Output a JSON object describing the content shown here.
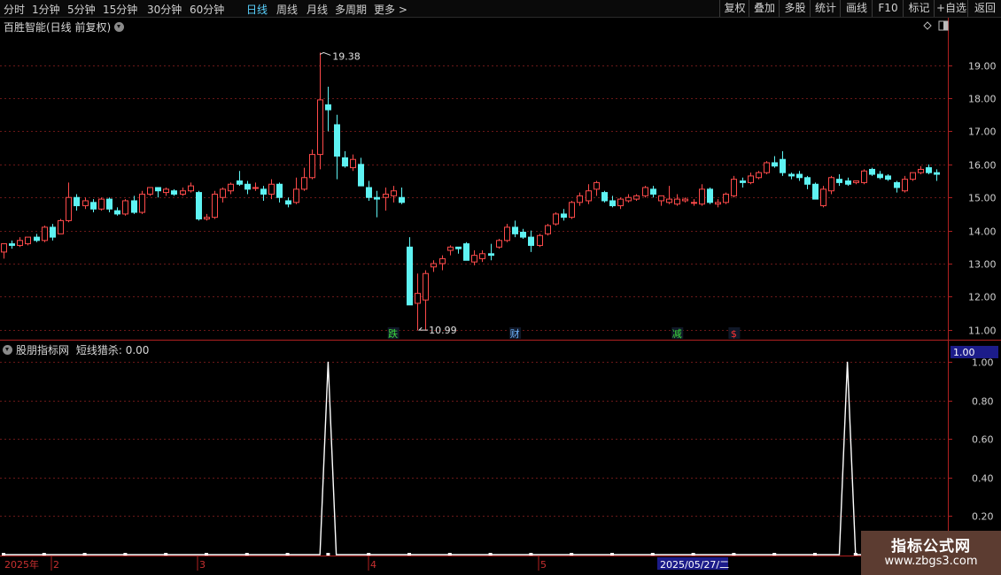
{
  "toolbar": {
    "periods": [
      "分时",
      "1分钟",
      "5分钟",
      "15分钟",
      "30分钟",
      "60分钟",
      "日线",
      "周线",
      "月线",
      "多周期",
      "更多 >"
    ],
    "active_period": "日线",
    "right_buttons": [
      "复权",
      "叠加",
      "多股",
      "统计",
      "画线",
      "F10",
      "标记",
      "+自选",
      "返回"
    ]
  },
  "main_panel": {
    "title": "百胜智能(日线 前复权)",
    "high_label": "19.38",
    "low_label": "10.99",
    "event_markers": [
      {
        "label": "跌",
        "color": "#3ddc3d",
        "date": "2025/04/08"
      },
      {
        "label": "财",
        "color": "#6fb5ff",
        "date": "2025/04/28"
      },
      {
        "label": "减",
        "color": "#3ddc3d",
        "date": "2025/05/23"
      },
      {
        "label": "$",
        "color": "#ff3333",
        "date": "2025/06/03"
      }
    ],
    "colors": {
      "up": "#ff4a4a",
      "down": "#5ef3f3",
      "axis": "#b02020"
    }
  },
  "sub_panel": {
    "title": "股朋指标网",
    "indicator_label": "短线猎杀:",
    "indicator_value": "0.00",
    "current_value_badge": "1.00"
  },
  "date_axis": {
    "labels": [
      "2025年",
      "2",
      "3",
      "4",
      "5"
    ],
    "cursor_date": "2025/05/27/二"
  },
  "watermark": {
    "line1": "指标公式网",
    "line2": "www.zbgs3.com"
  },
  "chart_data": [
    {
      "type": "candlestick",
      "title": "百胜智能(日线 前复权)",
      "ylim": [
        10.7,
        19.9
      ],
      "yticks": [
        11.0,
        12.0,
        13.0,
        14.0,
        15.0,
        16.0,
        17.0,
        18.0,
        19.0
      ],
      "columns": [
        "open",
        "high",
        "low",
        "close"
      ],
      "candles": [
        [
          13.35,
          13.5,
          13.15,
          13.6
        ],
        [
          13.6,
          13.7,
          13.45,
          13.55
        ],
        [
          13.55,
          13.8,
          13.5,
          13.7
        ],
        [
          13.6,
          13.8,
          13.55,
          13.8
        ],
        [
          13.8,
          13.9,
          13.65,
          13.7
        ],
        [
          13.7,
          14.15,
          13.65,
          14.1
        ],
        [
          14.1,
          14.2,
          13.7,
          13.8
        ],
        [
          13.9,
          14.35,
          13.9,
          14.3
        ],
        [
          14.3,
          15.45,
          14.25,
          15.0
        ],
        [
          15.0,
          15.1,
          14.6,
          14.75
        ],
        [
          14.75,
          15.0,
          14.65,
          14.9
        ],
        [
          14.85,
          14.95,
          14.55,
          14.65
        ],
        [
          14.65,
          15.0,
          14.6,
          14.95
        ],
        [
          14.95,
          15.0,
          14.55,
          14.65
        ],
        [
          14.6,
          14.7,
          14.45,
          14.5
        ],
        [
          14.5,
          14.95,
          14.45,
          14.9
        ],
        [
          14.9,
          15.05,
          14.5,
          14.55
        ],
        [
          14.55,
          15.2,
          14.5,
          15.1
        ],
        [
          15.1,
          15.3,
          15.05,
          15.3
        ],
        [
          15.3,
          15.3,
          15.0,
          15.2
        ],
        [
          15.15,
          15.3,
          15.05,
          15.25
        ],
        [
          15.2,
          15.25,
          15.05,
          15.1
        ],
        [
          15.1,
          15.3,
          15.05,
          15.2
        ],
        [
          15.2,
          15.45,
          15.15,
          15.35
        ],
        [
          15.15,
          15.2,
          14.3,
          14.35
        ],
        [
          14.35,
          14.5,
          14.3,
          14.4
        ],
        [
          14.4,
          15.2,
          14.35,
          15.1
        ],
        [
          15.0,
          15.3,
          14.85,
          15.25
        ],
        [
          15.2,
          15.45,
          15.1,
          15.4
        ],
        [
          15.5,
          15.8,
          15.35,
          15.4
        ],
        [
          15.4,
          15.5,
          15.1,
          15.25
        ],
        [
          15.3,
          15.45,
          15.2,
          15.3
        ],
        [
          15.25,
          15.35,
          14.9,
          15.1
        ],
        [
          15.1,
          15.55,
          14.95,
          15.4
        ],
        [
          15.4,
          15.45,
          14.85,
          15.0
        ],
        [
          14.9,
          15.0,
          14.7,
          14.8
        ],
        [
          14.85,
          15.6,
          14.8,
          15.25
        ],
        [
          15.25,
          15.9,
          15.2,
          15.6
        ],
        [
          15.6,
          16.45,
          15.55,
          16.3
        ],
        [
          16.3,
          19.38,
          15.85,
          17.95
        ],
        [
          17.8,
          18.35,
          17.0,
          17.65
        ],
        [
          17.2,
          17.5,
          15.55,
          16.25
        ],
        [
          16.2,
          16.4,
          15.9,
          15.95
        ],
        [
          15.9,
          16.3,
          15.8,
          16.15
        ],
        [
          16.0,
          16.2,
          15.4,
          15.35
        ],
        [
          15.3,
          15.5,
          14.9,
          15.0
        ],
        [
          15.0,
          15.2,
          14.4,
          14.95
        ],
        [
          15.0,
          15.3,
          14.6,
          15.1
        ],
        [
          15.05,
          15.35,
          14.85,
          15.2
        ],
        [
          15.0,
          15.3,
          14.8,
          14.85
        ],
        [
          13.5,
          13.8,
          12.05,
          11.75
        ],
        [
          11.8,
          12.7,
          10.99,
          12.1
        ],
        [
          11.9,
          12.8,
          11.0,
          12.7
        ],
        [
          12.9,
          13.1,
          12.75,
          13.0
        ],
        [
          13.0,
          13.25,
          12.8,
          13.15
        ],
        [
          13.4,
          13.55,
          13.25,
          13.5
        ],
        [
          13.5,
          13.5,
          13.3,
          13.45
        ],
        [
          13.6,
          13.65,
          13.1,
          13.1
        ],
        [
          13.05,
          13.4,
          12.95,
          13.25
        ],
        [
          13.15,
          13.4,
          13.05,
          13.3
        ],
        [
          13.3,
          13.6,
          13.1,
          13.25
        ],
        [
          13.5,
          13.75,
          13.45,
          13.7
        ],
        [
          13.7,
          14.2,
          13.65,
          14.1
        ],
        [
          14.1,
          14.3,
          13.8,
          13.9
        ],
        [
          13.95,
          14.05,
          13.75,
          13.8
        ],
        [
          13.8,
          14.0,
          13.35,
          13.55
        ],
        [
          13.55,
          13.9,
          13.5,
          13.85
        ],
        [
          13.9,
          14.2,
          13.85,
          14.15
        ],
        [
          14.2,
          14.55,
          14.15,
          14.5
        ],
        [
          14.5,
          14.65,
          14.3,
          14.4
        ],
        [
          14.4,
          14.9,
          14.35,
          14.85
        ],
        [
          14.85,
          15.15,
          14.75,
          15.05
        ],
        [
          14.9,
          15.4,
          14.8,
          15.2
        ],
        [
          15.25,
          15.5,
          15.05,
          15.45
        ],
        [
          15.15,
          15.2,
          14.85,
          14.9
        ],
        [
          14.9,
          15.05,
          14.7,
          14.75
        ],
        [
          14.75,
          15.0,
          14.65,
          14.95
        ],
        [
          14.9,
          15.1,
          14.85,
          15.0
        ],
        [
          14.95,
          15.1,
          14.9,
          15.05
        ],
        [
          15.05,
          15.35,
          15.0,
          15.3
        ],
        [
          15.25,
          15.35,
          15.0,
          15.1
        ],
        [
          14.9,
          15.0,
          14.75,
          15.05
        ],
        [
          14.85,
          15.35,
          14.8,
          14.95
        ],
        [
          14.8,
          15.1,
          14.75,
          14.95
        ],
        [
          14.9,
          15.0,
          14.85,
          14.95
        ],
        [
          14.85,
          14.95,
          14.75,
          14.85
        ],
        [
          14.8,
          15.4,
          14.75,
          15.25
        ],
        [
          15.25,
          15.3,
          14.8,
          14.85
        ],
        [
          14.8,
          14.95,
          14.7,
          14.85
        ],
        [
          14.85,
          15.15,
          14.8,
          15.1
        ],
        [
          15.05,
          15.65,
          15.0,
          15.55
        ],
        [
          15.5,
          15.6,
          15.3,
          15.45
        ],
        [
          15.45,
          15.75,
          15.4,
          15.65
        ],
        [
          15.6,
          15.8,
          15.55,
          15.75
        ],
        [
          15.75,
          16.1,
          15.7,
          16.05
        ],
        [
          16.05,
          16.25,
          15.9,
          15.95
        ],
        [
          16.15,
          16.4,
          15.65,
          15.75
        ],
        [
          15.7,
          15.75,
          15.55,
          15.65
        ],
        [
          15.7,
          15.8,
          15.5,
          15.6
        ],
        [
          15.6,
          15.65,
          15.25,
          15.4
        ],
        [
          15.4,
          15.45,
          15.0,
          14.95
        ],
        [
          14.75,
          15.35,
          14.7,
          15.25
        ],
        [
          15.2,
          15.65,
          15.1,
          15.6
        ],
        [
          15.55,
          15.7,
          15.35,
          15.45
        ],
        [
          15.5,
          15.6,
          15.35,
          15.4
        ],
        [
          15.45,
          15.5,
          15.4,
          15.5
        ],
        [
          15.45,
          15.85,
          15.4,
          15.8
        ],
        [
          15.85,
          15.9,
          15.65,
          15.7
        ],
        [
          15.7,
          15.8,
          15.55,
          15.6
        ],
        [
          15.65,
          15.7,
          15.5,
          15.55
        ],
        [
          15.45,
          15.5,
          15.15,
          15.3
        ],
        [
          15.2,
          15.65,
          15.15,
          15.55
        ],
        [
          15.55,
          15.75,
          15.5,
          15.75
        ],
        [
          15.75,
          15.95,
          15.7,
          15.85
        ],
        [
          15.9,
          16.0,
          15.7,
          15.75
        ],
        [
          15.75,
          15.85,
          15.5,
          15.7
        ]
      ]
    },
    {
      "type": "line",
      "title": "短线猎杀",
      "ylim": [
        0,
        1.05
      ],
      "yticks": [
        0.2,
        0.4,
        0.6,
        0.8,
        1.0
      ],
      "series": [
        {
          "name": "短线猎杀",
          "spike_indices": [
            40,
            104
          ],
          "length": 116
        }
      ]
    }
  ]
}
